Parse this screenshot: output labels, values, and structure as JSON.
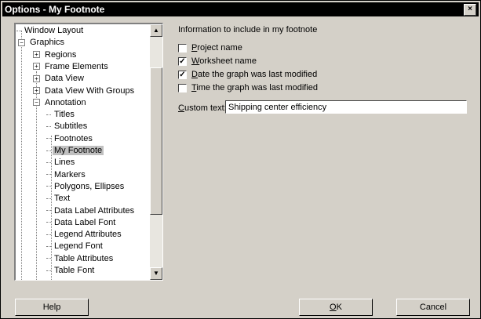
{
  "window": {
    "title": "Options - My Footnote",
    "close_glyph": "×"
  },
  "tree": {
    "items": [
      {
        "label": "Window Layout",
        "level": 0,
        "expander": ""
      },
      {
        "label": "Graphics",
        "level": 0,
        "expander": "−"
      },
      {
        "label": "Regions",
        "level": 1,
        "expander": "+"
      },
      {
        "label": "Frame Elements",
        "level": 1,
        "expander": "+"
      },
      {
        "label": "Data View",
        "level": 1,
        "expander": "+"
      },
      {
        "label": "Data View With Groups",
        "level": 1,
        "expander": "+"
      },
      {
        "label": "Annotation",
        "level": 1,
        "expander": "−"
      },
      {
        "label": "Titles",
        "level": 2,
        "expander": ""
      },
      {
        "label": "Subtitles",
        "level": 2,
        "expander": ""
      },
      {
        "label": "Footnotes",
        "level": 2,
        "expander": ""
      },
      {
        "label": "My Footnote",
        "level": 2,
        "expander": "",
        "selected": true
      },
      {
        "label": "Lines",
        "level": 2,
        "expander": ""
      },
      {
        "label": "Markers",
        "level": 2,
        "expander": ""
      },
      {
        "label": "Polygons, Ellipses",
        "level": 2,
        "expander": ""
      },
      {
        "label": "Text",
        "level": 2,
        "expander": ""
      },
      {
        "label": "Data Label Attributes",
        "level": 2,
        "expander": ""
      },
      {
        "label": "Data Label Font",
        "level": 2,
        "expander": ""
      },
      {
        "label": "Legend Attributes",
        "level": 2,
        "expander": ""
      },
      {
        "label": "Legend Font",
        "level": 2,
        "expander": ""
      },
      {
        "label": "Table Attributes",
        "level": 2,
        "expander": ""
      },
      {
        "label": "Table Font",
        "level": 2,
        "expander": ""
      }
    ],
    "scroll_up_glyph": "▲",
    "scroll_down_glyph": "▼"
  },
  "panel": {
    "info_label": "Information to include in my footnote",
    "options": [
      {
        "mnemonic": "P",
        "rest": "roject name",
        "checked": false
      },
      {
        "mnemonic": "W",
        "rest": "orksheet name",
        "checked": true
      },
      {
        "mnemonic": "D",
        "rest": "ate the graph was last modified",
        "checked": true
      },
      {
        "mnemonic": "T",
        "rest": "ime the graph was last modified",
        "checked": false
      }
    ],
    "custom_label_mnemonic": "C",
    "custom_label_rest": "ustom text:",
    "custom_text_value": "Shipping center efficiency"
  },
  "buttons": {
    "help": "Help",
    "ok_mnemonic": "O",
    "ok_rest": "K",
    "cancel": "Cancel"
  },
  "check_glyph": "✓"
}
